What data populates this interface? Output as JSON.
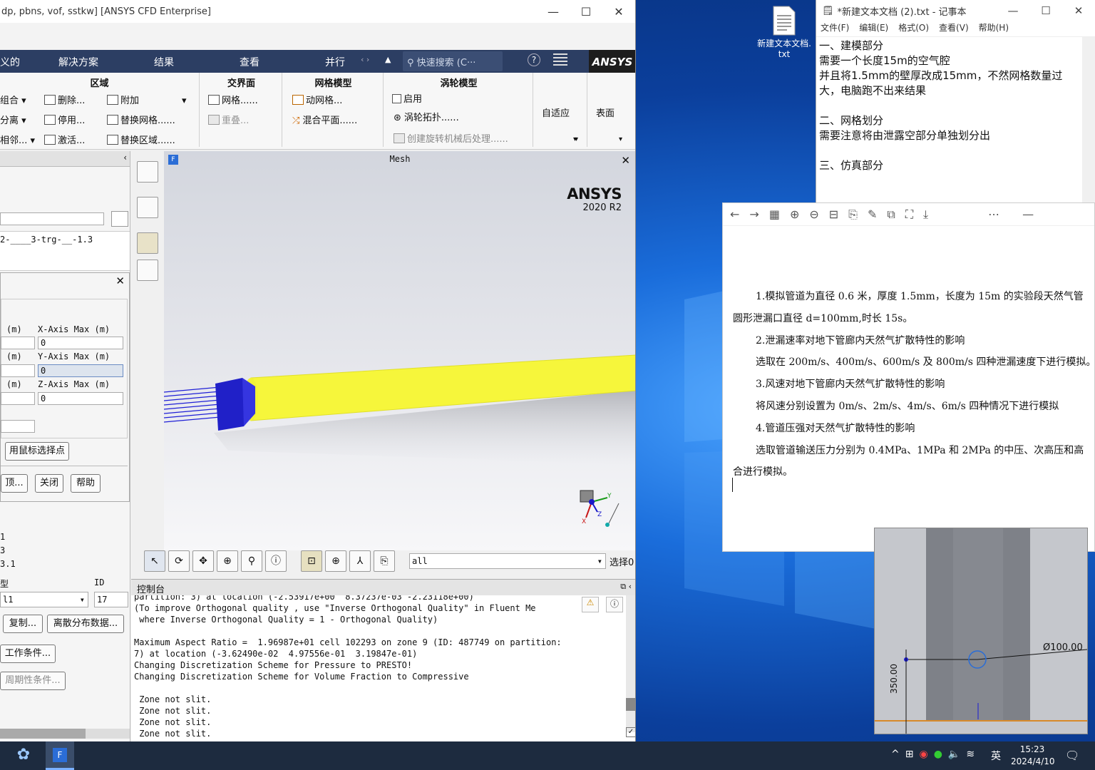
{
  "fluent": {
    "title": "dp, pbns, vof, sstkw] [ANSYS CFD Enterprise]",
    "window_controls": [
      "—",
      "☐",
      "✕"
    ],
    "menubar": {
      "items": [
        "义的",
        "解决方案",
        "结果",
        "查看",
        "并行"
      ],
      "search_placeholder": "快速搜索 (C···",
      "logo": "ANSYS"
    },
    "ribbon": {
      "zone_group": {
        "title": "区域",
        "items": [
          "组合",
          "分离",
          "相邻...",
          "删除...",
          "停用...",
          "激活...",
          "附加",
          "替换网格......",
          "替换区域......"
        ]
      },
      "interface_group": {
        "title": "交界面",
        "items": [
          "网格......",
          "重叠..."
        ]
      },
      "mesh_model_group": {
        "title": "网格模型",
        "items": [
          "动网格...",
          "混合平面......"
        ]
      },
      "turbo_group": {
        "title": "涡轮模型",
        "items": [
          "启用",
          "涡轮拓扑......",
          "创建旋转机械后处理......"
        ]
      },
      "adapt": "自适应",
      "surface": "表面"
    },
    "left_panel": {
      "tree_text": "2-____3-trg-__-1.3",
      "unit_m": "(m)",
      "x_max_label": "X-Axis Max (m)",
      "y_max_label": "Y-Axis Max (m)",
      "z_max_label": "Z-Axis Max (m)",
      "x_max_value": "0",
      "y_max_value": "0",
      "z_max_value": "0",
      "select_points_button": "用鼠标选择点",
      "options_button": "顶...",
      "close_button": "关闭",
      "help_button": "帮助",
      "list_fragments": [
        "1",
        "3",
        "3.1"
      ],
      "type_label": "型",
      "id_label": "ID",
      "type_value": "l1",
      "id_value": "17",
      "copy_button": "复制...",
      "discrete_button": "离散分布数据...",
      "operating_button": "工作条件...",
      "periodic_button": "周期性条件..."
    },
    "graphics": {
      "title": "Mesh",
      "brand": "ANSYS",
      "version": "2020 R2"
    },
    "bottom_toolbar": {
      "select_value": "all",
      "select_status": "选择0"
    },
    "console": {
      "title": "控制台",
      "lines": [
        "partition: 3) at location (-2.53917e+00  8.37237e-03 -2.23118e+00)",
        "(To improve Orthogonal quality , use \"Inverse Orthogonal Quality\" in Fluent Me",
        " where Inverse Orthogonal Quality = 1 - Orthogonal Quality)",
        "",
        "Maximum Aspect Ratio =  1.96987e+01 cell 102293 on zone 9 (ID: 487749 on partition:",
        "7) at location (-3.62490e-02  4.97556e-01  3.19847e-01)",
        "Changing Discretization Scheme for Pressure to PRESTO!",
        "Changing Discretization Scheme for Volume Fraction to Compressive",
        "",
        " Zone not slit.",
        " Zone not slit.",
        " Zone not slit.",
        " Zone not slit."
      ]
    }
  },
  "desktop_icon": {
    "label": "新建文本文档.txt"
  },
  "notepad": {
    "title": "*新建文本文档 (2).txt - 记事本",
    "menu": [
      "文件(F)",
      "编辑(E)",
      "格式(O)",
      "查看(V)",
      "帮助(H)"
    ],
    "lines": [
      "一、建模部分",
      "需要一个长度15m的空气腔",
      "并且将1.5mm的壁厚改成15mm，不然网格数量过",
      "大，电脑跑不出来结果",
      "",
      "二、网格划分",
      "需要注意将由泄露空部分单独划分出",
      "",
      "三、仿真部分"
    ]
  },
  "docview": {
    "lines": [
      "1.模拟管道为直径 0.6 米，厚度 1.5mm，长度为 15m 的实验段天然气管",
      "圆形泄漏口直径 d=100mm,时长 15s。",
      "2.泄漏速率对地下管廊内天然气扩散特性的影响",
      "选取在 200m/s、400m/s、600m/s 及 800m/s 四种泄漏速度下进行模拟。",
      "3.风速对地下管廊内天然气扩散特性的影响",
      "将风速分别设置为 0m/s、2m/s、4m/s、6m/s 四种情况下进行模拟",
      "4.管道压强对天然气扩散特性的影响",
      "选取管道输送压力分别为 0.4MPa、1MPa 和 2MPa 的中压、次高压和高",
      "合进行模拟。"
    ]
  },
  "cad": {
    "dim_diameter": "Ø100.00",
    "dim_height": "350.00"
  },
  "taskbar": {
    "ime": "英",
    "time": "15:23",
    "date": "2024/4/10"
  }
}
